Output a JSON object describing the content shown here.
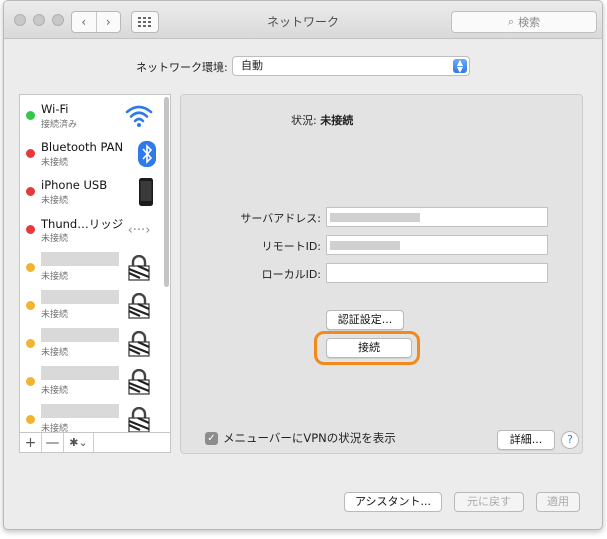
{
  "window": {
    "title": "ネットワーク"
  },
  "toolbar": {
    "back_glyph": "‹",
    "forward_glyph": "›",
    "search_placeholder": "検索",
    "search_glyph": "⌕"
  },
  "location": {
    "label": "ネットワーク環境:",
    "value": "自動"
  },
  "services": [
    {
      "name": "Wi-Fi",
      "status": "接続済み",
      "dot": "#34c84a",
      "icon": "wifi-icon"
    },
    {
      "name": "Bluetooth PAN",
      "status": "未接続",
      "dot": "#e5393b",
      "icon": "bluetooth-icon"
    },
    {
      "name": "iPhone USB",
      "status": "未接続",
      "dot": "#e5393b",
      "icon": "iphone-icon"
    },
    {
      "name": "Thund…リッジ",
      "status": "未接続",
      "dot": "#e5393b",
      "icon": "thunderbolt-bridge-icon",
      "glyph": "‹···›"
    },
    {
      "name": "",
      "status": "未接続",
      "dot": "#f2b330",
      "icon": "vpn-lock-icon"
    },
    {
      "name": "",
      "status": "未接続",
      "dot": "#f2b330",
      "icon": "vpn-lock-icon"
    },
    {
      "name": "",
      "status": "未接続",
      "dot": "#f2b330",
      "icon": "vpn-lock-icon"
    },
    {
      "name": "",
      "status": "未接続",
      "dot": "#f2b330",
      "icon": "vpn-lock-icon"
    },
    {
      "name": "",
      "status": "未接続",
      "dot": "#f2b330",
      "icon": "vpn-lock-icon"
    }
  ],
  "list_tools": {
    "add": "+",
    "remove": "—",
    "gear": "✱⌄"
  },
  "detail": {
    "status_label": "状況:",
    "status_value": "未接続",
    "server_label": "サーバアドレス:",
    "server_value": "",
    "remote_id_label": "リモートID:",
    "remote_id_value": "",
    "local_id_label": "ローカルID:",
    "local_id_value": "",
    "auth_button": "認証設定...",
    "connect_button": "接続",
    "show_vpn_label": "メニューバーにVPNの状況を表示",
    "checkbox_glyph": "✓",
    "advanced_button": "詳細...",
    "help_glyph": "?"
  },
  "footer": {
    "assistant": "アシスタント...",
    "revert": "元に戻す",
    "apply": "適用"
  },
  "colors": {
    "accent": "#2f7ae9",
    "highlight": "#f08a1c"
  }
}
